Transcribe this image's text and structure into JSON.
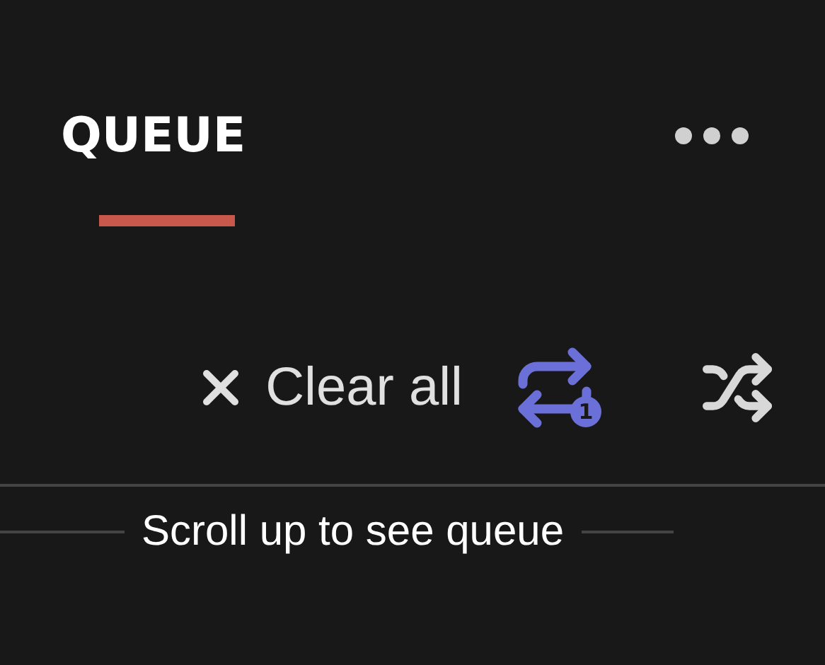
{
  "tabs": [
    {
      "label": "QUEUE",
      "selected": true
    }
  ],
  "actions": {
    "clear_label": "Clear all",
    "repeat": {
      "on": true,
      "one": true,
      "badge": "1"
    },
    "shuffle": {
      "on": false
    }
  },
  "footer": {
    "hint": "Scroll up to see queue"
  }
}
